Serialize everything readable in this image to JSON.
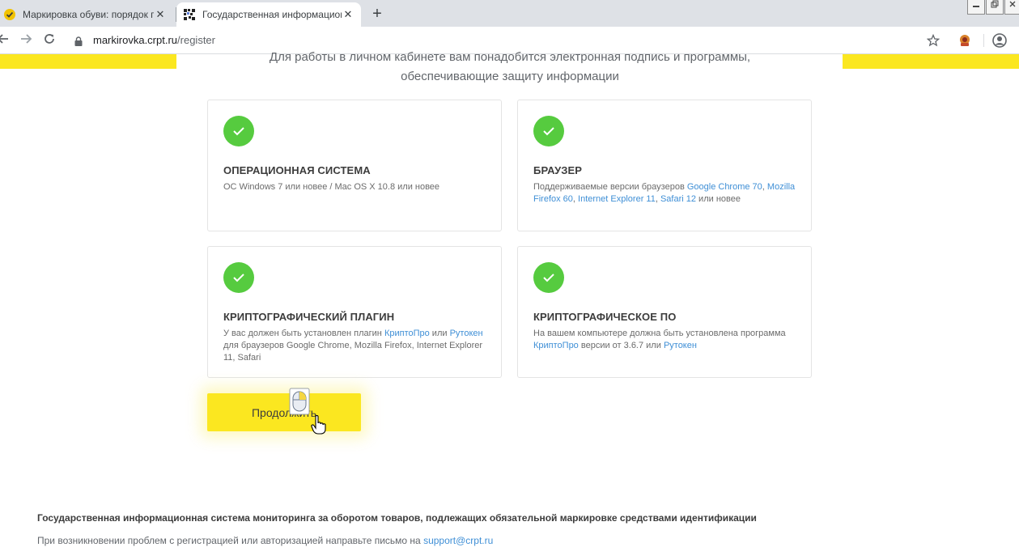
{
  "browser": {
    "tabs": [
      {
        "title": "Маркировка обуви: порядок пр",
        "active": false,
        "favicon": "yellow-check-icon"
      },
      {
        "title": "Государственная информацион",
        "active": true,
        "favicon": "crpt-logo-icon"
      }
    ],
    "close_glyph": "✕",
    "new_tab_glyph": "+",
    "url_host": "markirovka.crpt.ru",
    "url_path": "/register"
  },
  "main": {
    "intro_line1": "Для работы в личном кабинете вам понадобится электронная подпись и программы,",
    "intro_line2": "обеспечивающие защиту информации",
    "cards": [
      {
        "title": "ОПЕРАЦИОННАЯ СИСТЕМА",
        "desc": "ОС Windows 7 или новее / Mac OS X 10.8 или новее"
      },
      {
        "title": "БРАУЗЕР",
        "desc_prefix": "Поддерживаемые версии браузеров ",
        "links": [
          "Google Chrome 70",
          "Mozilla Firefox 60",
          "Internet Explorer 11",
          "Safari 12"
        ],
        "sep": ", ",
        "desc_suffix": " или новее"
      },
      {
        "title": "КРИПТОГРАФИЧЕСКИЙ ПЛАГИН",
        "desc_a": "У вас должен быть установлен плагин ",
        "link1": "КриптоПро",
        "desc_b": " или ",
        "link2": "Рутокен",
        "desc_c": " для браузеров Google Chrome, Mozilla Firefox, Internet Explorer 11, Safari"
      },
      {
        "title": "КРИПТОГРАФИЧЕСКОЕ ПО",
        "desc_a": "На вашем компьютере должна быть установлена программа ",
        "link1": "КриптоПро",
        "desc_b": " версии от 3.6.7 или ",
        "link2": "Рутокен"
      }
    ],
    "continue_label": "Продолжить"
  },
  "footer": {
    "title": "Государственная информационная система мониторинга за оборотом товаров, подлежащих обязательной маркировке средствами идентификации",
    "help_text": "При возникновении проблем с регистрацией или авторизацией направьте письмо на ",
    "help_email": "support@crpt.ru"
  },
  "colors": {
    "accent_yellow": "#fbe720",
    "check_green": "#56cb3f",
    "link_blue": "#3f8fd6"
  }
}
